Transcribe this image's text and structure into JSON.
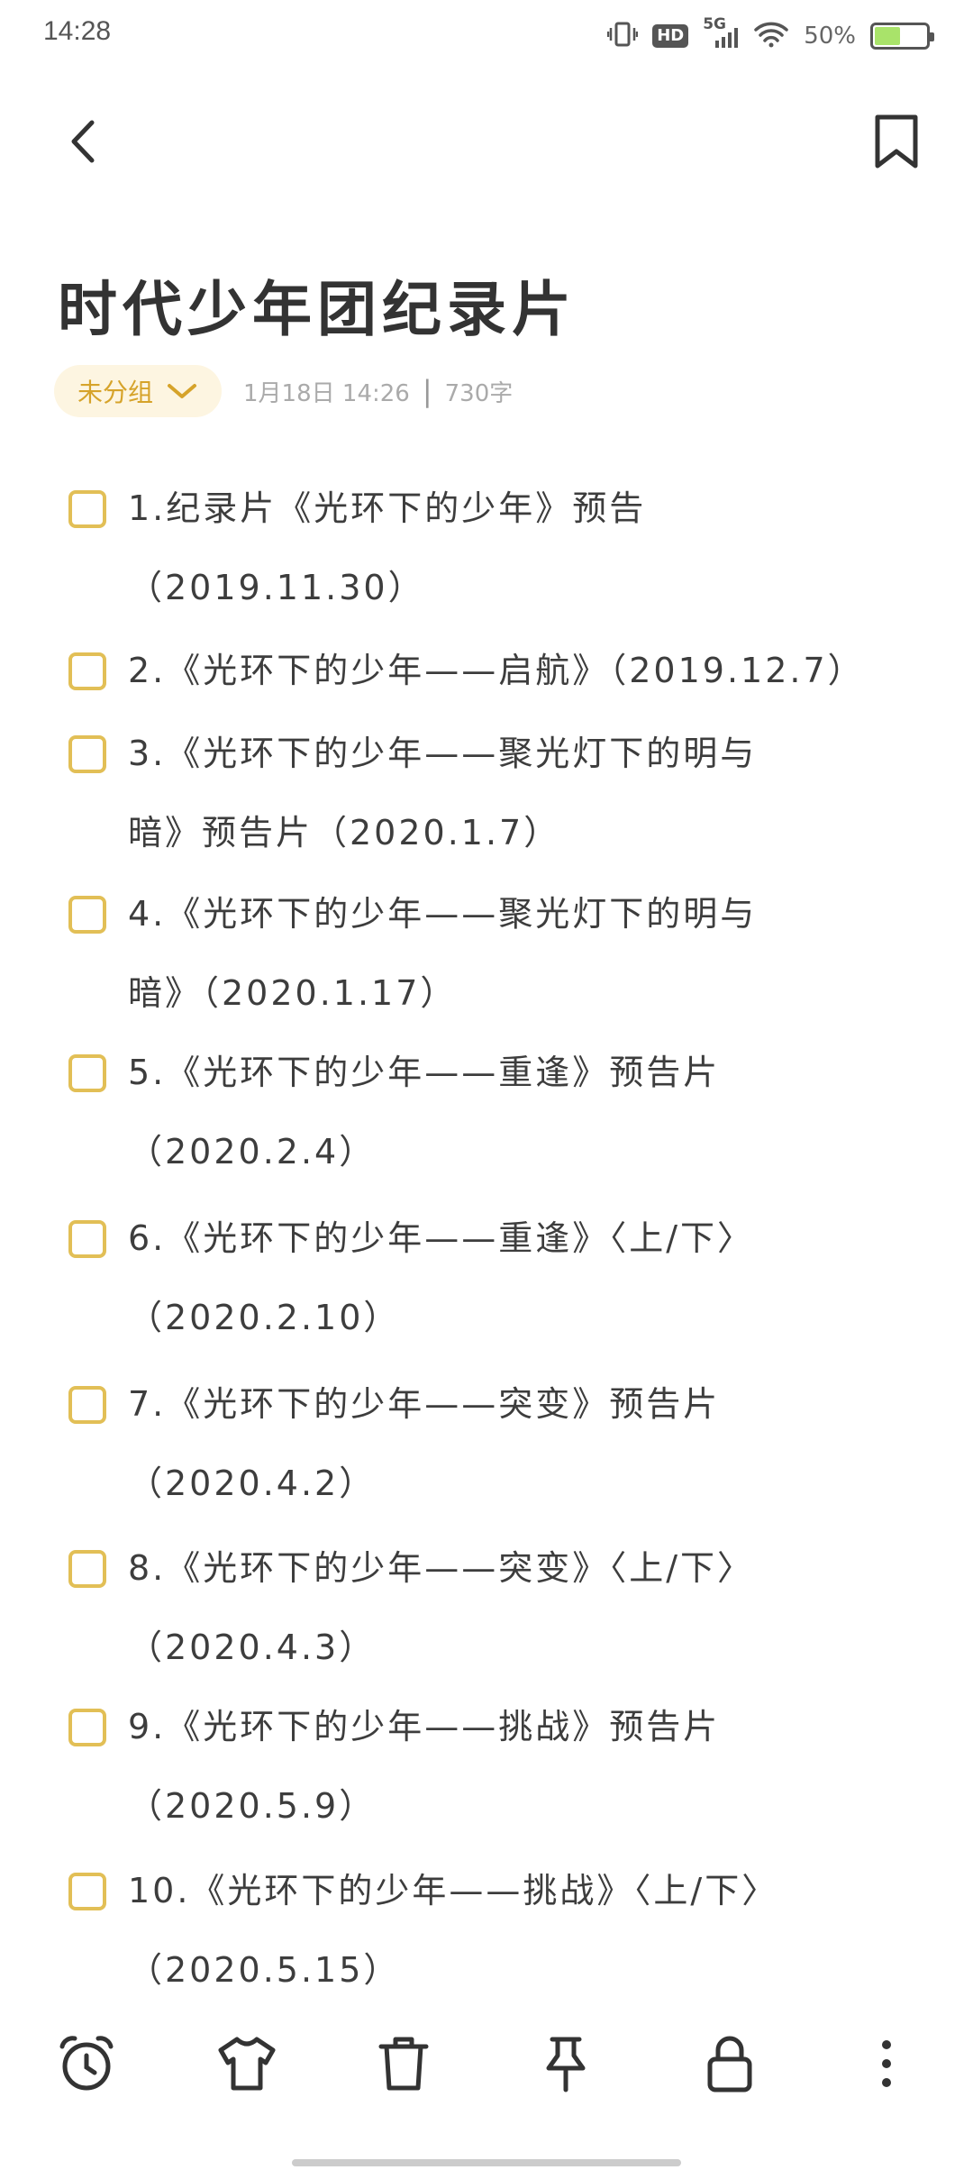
{
  "status_bar": {
    "time": "14:28",
    "network": "5G",
    "hd": "HD",
    "battery_percent_text": "50%",
    "battery_level": 0.5
  },
  "note": {
    "title": "时代少年团纪录片",
    "group": "未分组",
    "date": "1月18日 14:26",
    "separator": "|",
    "word_count": "730字"
  },
  "checklist": [
    {
      "text": "1.纪录片《光环下的少年》预告",
      "text2": "（2019.11.30）",
      "checked": false
    },
    {
      "text": "2.《光环下的少年——启航》（2019.12.7）",
      "text2": "",
      "checked": false
    },
    {
      "text": "3.《光环下的少年——聚光灯下的明与",
      "text2": "暗》预告片（2020.1.7）",
      "checked": false
    },
    {
      "text": "4.《光环下的少年——聚光灯下的明与",
      "text2": "暗》（2020.1.17）",
      "checked": false
    },
    {
      "text": "5.《光环下的少年——重逢》预告片",
      "text2": "（2020.2.4）",
      "checked": false
    },
    {
      "text": "6.《光环下的少年——重逢》〈上/下〉",
      "text2": "（2020.2.10）",
      "checked": false
    },
    {
      "text": "7.《光环下的少年——突变》预告片",
      "text2": "（2020.4.2）",
      "checked": false
    },
    {
      "text": "8.《光环下的少年——突变》〈上/下〉",
      "text2": "（2020.4.3）",
      "checked": false
    },
    {
      "text": "9.《光环下的少年——挑战》预告片",
      "text2": "（2020.5.9）",
      "checked": false
    },
    {
      "text": "10.《光环下的少年——挑战》〈上/下〉",
      "text2": "（2020.5.15）",
      "checked": false
    }
  ],
  "colors": {
    "accent": "#e2bf56",
    "chip_bg": "#fdf5e1",
    "chip_text": "#d6a32a",
    "text": "#3d3d3d",
    "battery_fill": "#a9e36a"
  },
  "toolbar": {
    "icons": [
      "alarm-clock-icon",
      "shirt-icon",
      "trash-icon",
      "pin-icon",
      "lock-icon",
      "more-vertical-icon"
    ]
  }
}
